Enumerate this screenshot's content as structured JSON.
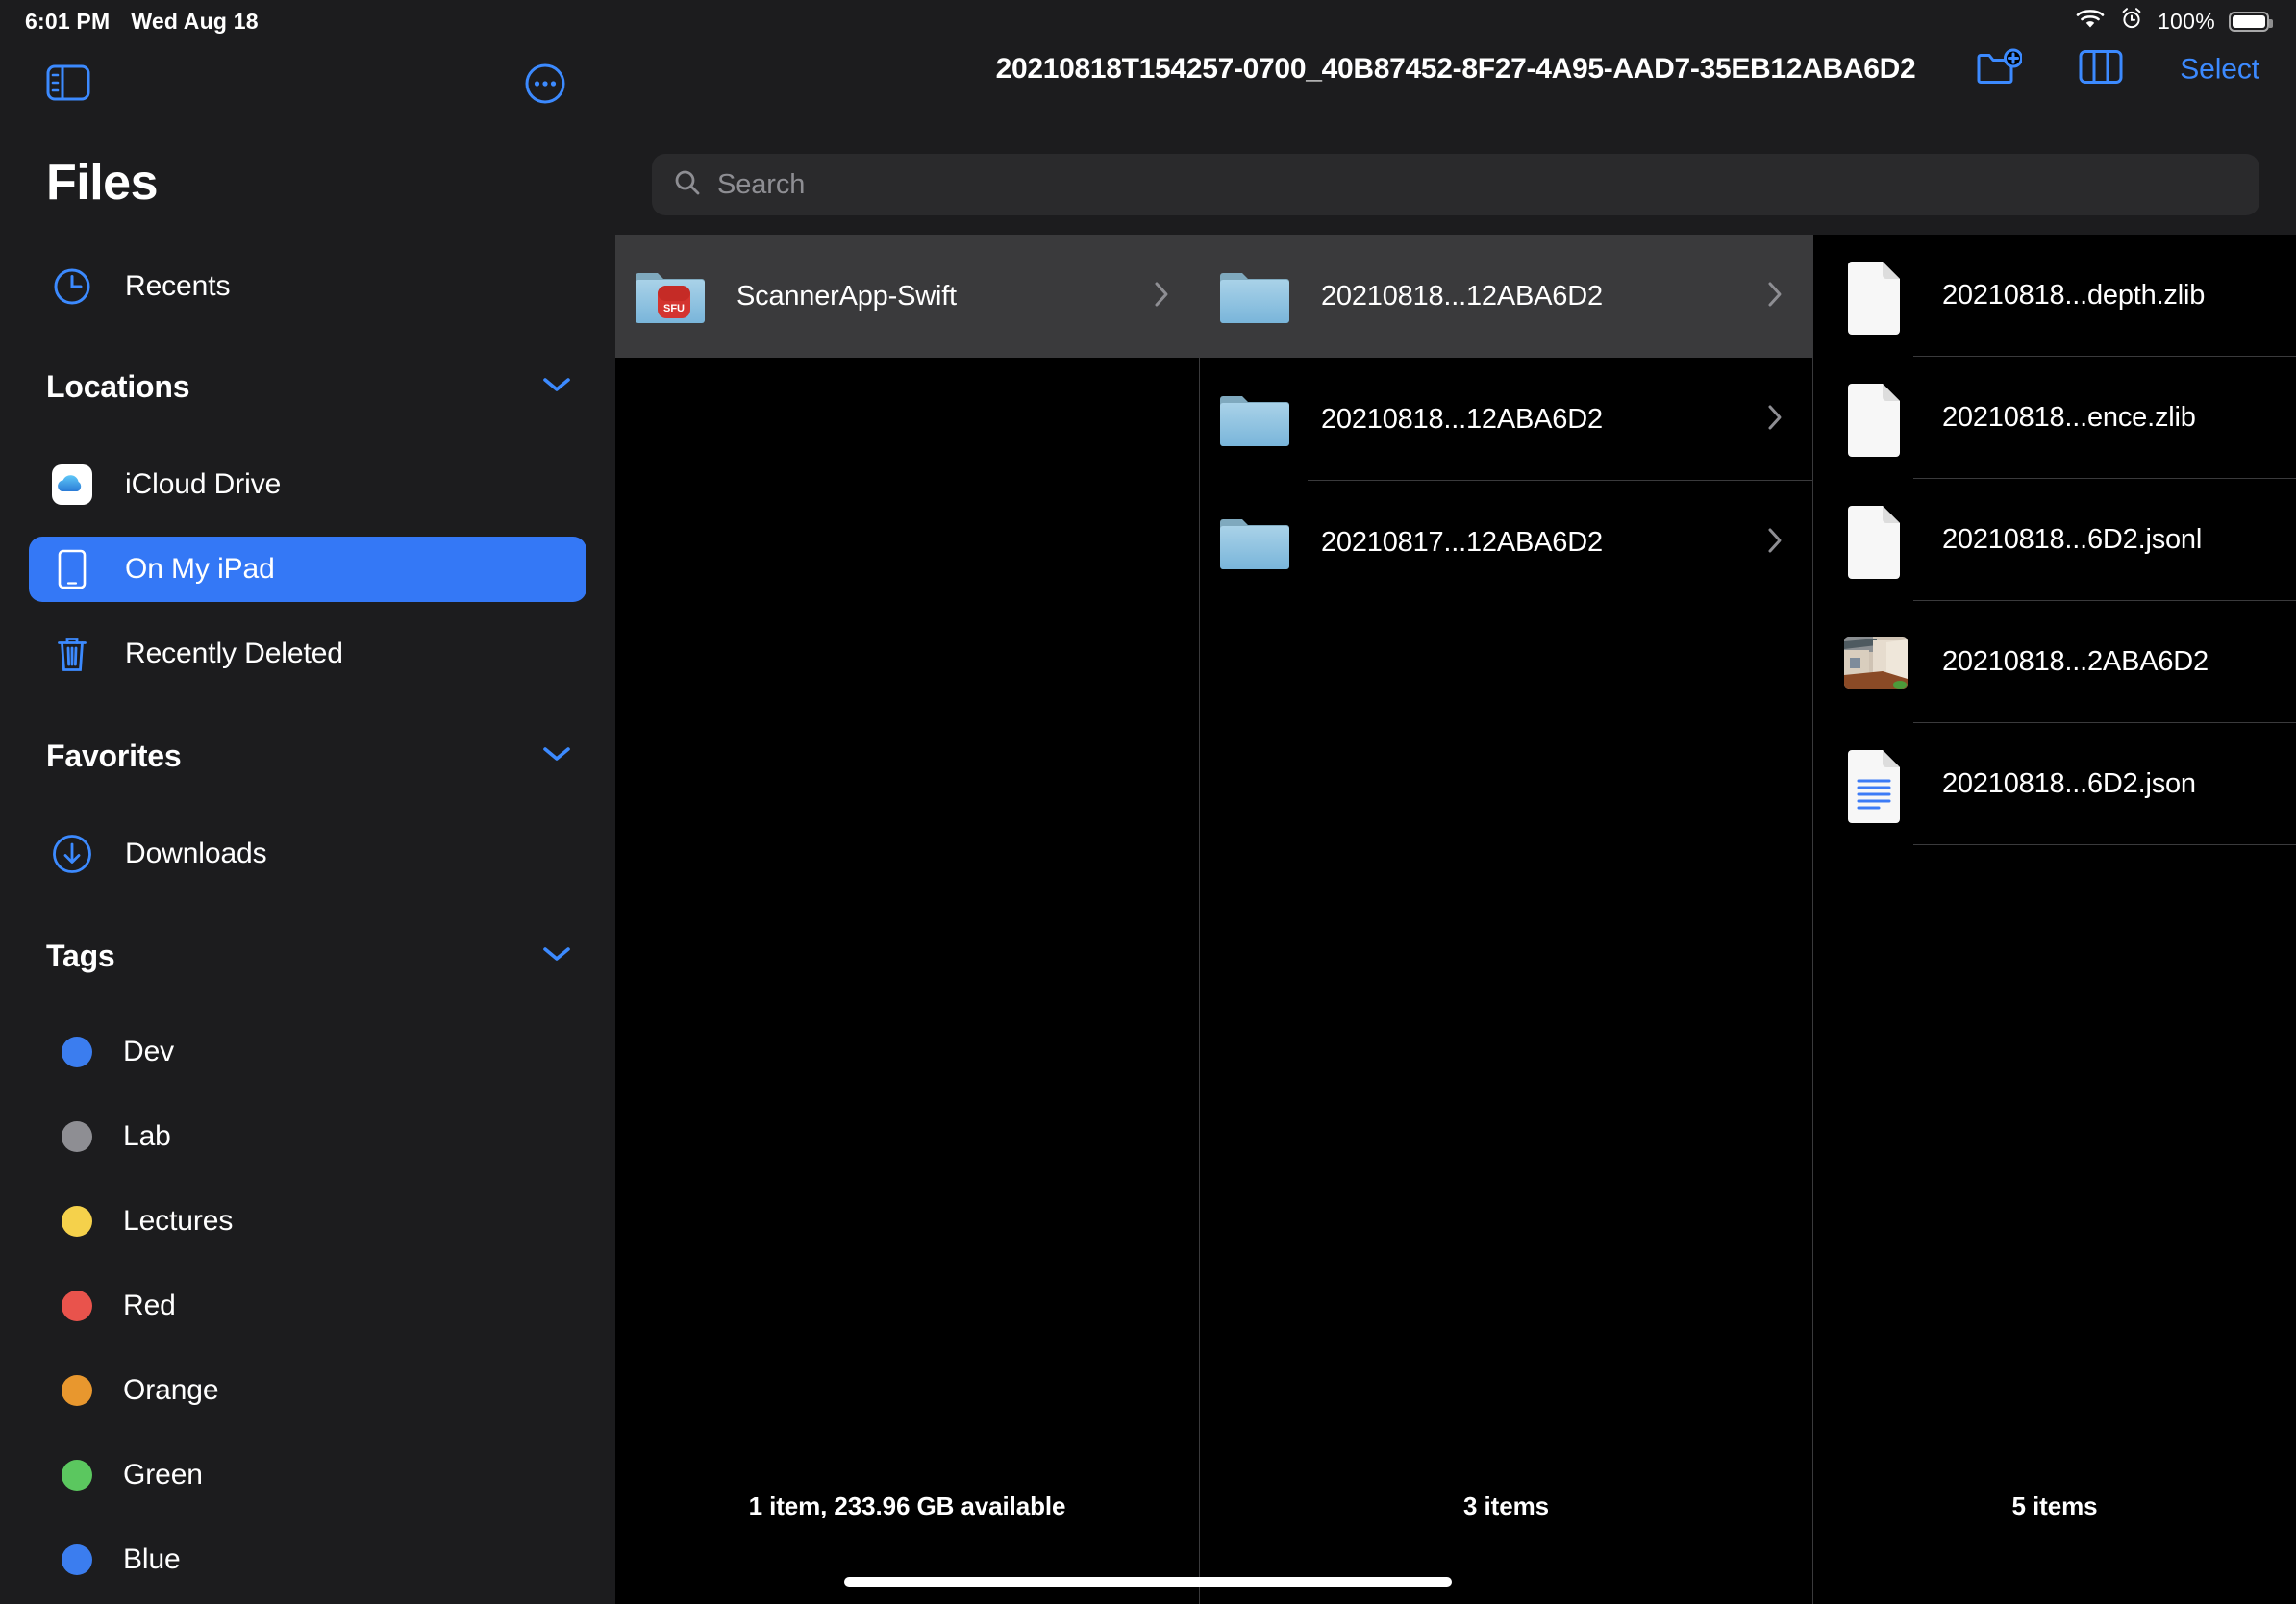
{
  "statusbar": {
    "time": "6:01 PM",
    "date": "Wed Aug 18",
    "wifi_icon": "wifi-icon",
    "alarm_icon": "alarm-clock-icon",
    "battery_percent": "100%",
    "battery_icon": "battery-full-icon"
  },
  "sidebar": {
    "toggle_icon": "sidebar-toggle-icon",
    "more_icon": "more-ellipsis-icon",
    "title": "Files",
    "recents": {
      "label": "Recents",
      "icon": "clock-icon"
    },
    "sections": [
      {
        "title": "Locations",
        "chevron_icon": "chevron-down-icon",
        "items": [
          {
            "label": "iCloud Drive",
            "icon": "icloud-drive-icon",
            "selected": false
          },
          {
            "label": "On My iPad",
            "icon": "ipad-icon",
            "selected": true
          },
          {
            "label": "Recently Deleted",
            "icon": "trash-icon",
            "selected": false
          }
        ]
      },
      {
        "title": "Favorites",
        "chevron_icon": "chevron-down-icon",
        "items": [
          {
            "label": "Downloads",
            "icon": "download-circle-icon",
            "selected": false
          }
        ]
      }
    ],
    "tags_section": {
      "title": "Tags",
      "chevron_icon": "chevron-down-icon",
      "tags": [
        {
          "label": "Dev",
          "color": "#3B7DEF"
        },
        {
          "label": "Lab",
          "color": "#8E8E93"
        },
        {
          "label": "Lectures",
          "color": "#F5D14B"
        },
        {
          "label": "Red",
          "color": "#E9534C"
        },
        {
          "label": "Orange",
          "color": "#E8972E"
        },
        {
          "label": "Green",
          "color": "#5BC75F"
        },
        {
          "label": "Blue",
          "color": "#3B7DEF"
        }
      ]
    },
    "accent_color": "#3478F6",
    "selected_row_color": "#3478F6"
  },
  "navbar": {
    "title": "20210818T154257-0700_40B87452-8F27-4A95-AAD7-35EB12ABA6D2",
    "new_folder_icon": "new-folder-icon",
    "column_view_icon": "column-view-icon",
    "select_label": "Select",
    "accent_color": "#3C8AFF"
  },
  "search": {
    "placeholder": "Search",
    "icon": "search-icon"
  },
  "columns": [
    {
      "name": "column-one",
      "footer": "1 item, 233.96 GB available",
      "rows": [
        {
          "name": "ScannerApp-Swift",
          "icon": "folder-app-icon",
          "badge_text": "SFU",
          "selected": true,
          "chevron_icon": "chevron-right-icon"
        }
      ]
    },
    {
      "name": "column-two",
      "footer": "3 items",
      "rows": [
        {
          "name": "20210818...12ABA6D2",
          "icon": "folder-icon",
          "selected": true,
          "chevron_icon": "chevron-right-icon"
        },
        {
          "name": "20210818...12ABA6D2",
          "icon": "folder-icon",
          "selected": false,
          "chevron_icon": "chevron-right-icon"
        },
        {
          "name": "20210817...12ABA6D2",
          "icon": "folder-icon",
          "selected": false,
          "chevron_icon": "chevron-right-icon"
        }
      ]
    },
    {
      "name": "column-three",
      "footer": "5 items",
      "rows": [
        {
          "name": "20210818...depth.zlib",
          "icon": "blank-document-icon",
          "selected": false
        },
        {
          "name": "20210818...ence.zlib",
          "icon": "blank-document-icon",
          "selected": false
        },
        {
          "name": "20210818...6D2.jsonl",
          "icon": "blank-document-icon",
          "selected": false
        },
        {
          "name": "20210818...2ABA6D2",
          "icon": "photo-thumbnail-icon",
          "selected": false
        },
        {
          "name": "20210818...6D2.json",
          "icon": "text-document-icon",
          "selected": false
        }
      ]
    }
  ],
  "home_indicator": "home-indicator"
}
